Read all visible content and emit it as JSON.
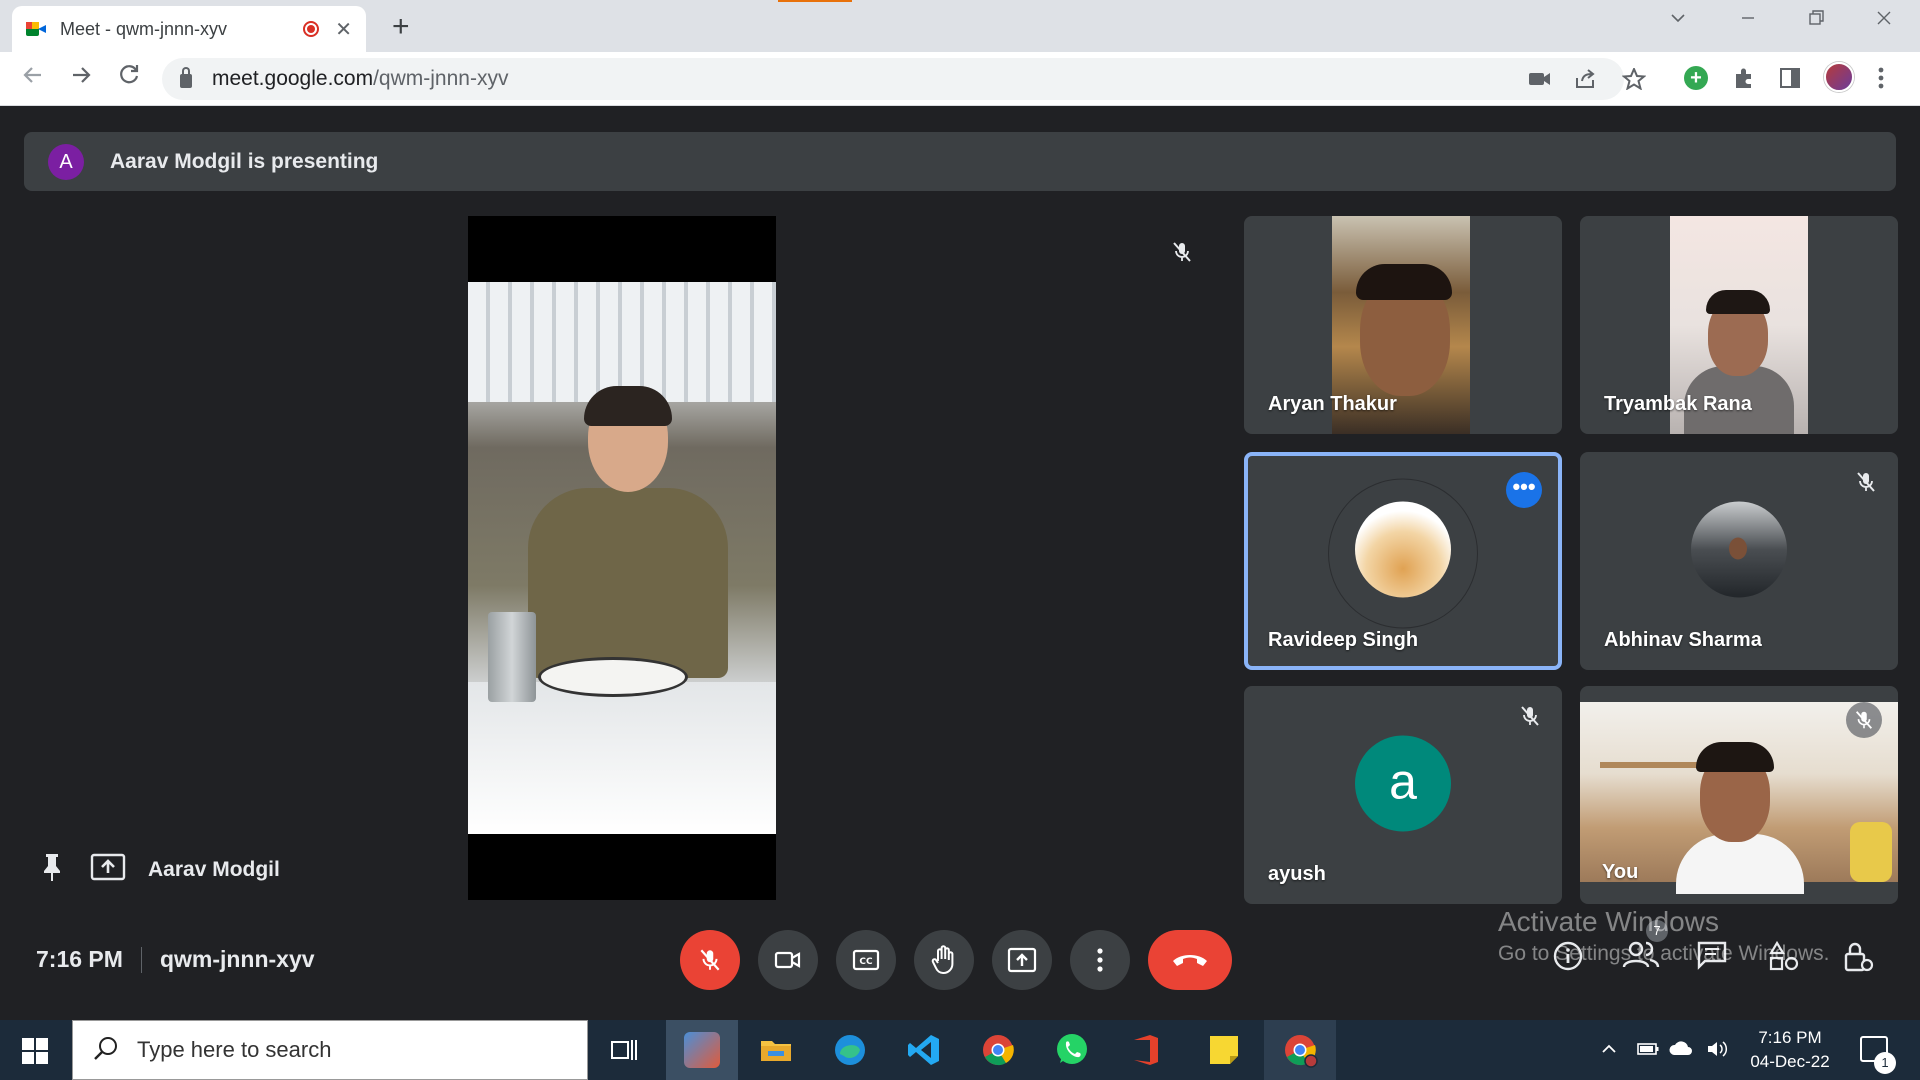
{
  "browser": {
    "tab_title": "Meet - qwm-jnnn-xyv",
    "tab_close": "✕",
    "new_tab": "+",
    "url_host": "meet.google.com",
    "url_path": "/qwm-jnnn-xyv"
  },
  "meet": {
    "presenting_avatar_letter": "A",
    "presenting_text": "Aarav Modgil is presenting",
    "pinned_name": "Aarav Modgil",
    "time": "7:16 PM",
    "meeting_code": "qwm-jnnn-xyv",
    "participant_count": "7",
    "participants": [
      {
        "name": "Aryan Thakur"
      },
      {
        "name": "Tryambak Rana"
      },
      {
        "name": "Ravideep Singh",
        "more": "•••"
      },
      {
        "name": "Abhinav Sharma"
      },
      {
        "name": "ayush",
        "avatar_letter": "a"
      },
      {
        "name": "You"
      }
    ]
  },
  "watermark": {
    "line1": "Activate Windows",
    "line2": "Go to Settings to activate Windows."
  },
  "taskbar": {
    "search_placeholder": "Type here to search",
    "time": "7:16 PM",
    "date": "04-Dec-22",
    "notification_count": "1"
  },
  "colors": {
    "meet_bg": "#202124",
    "tile_bg": "#3c4043",
    "end_call": "#ea4335",
    "active_border": "#8ab4f8",
    "taskbar_bg": "#1c2b3a"
  }
}
